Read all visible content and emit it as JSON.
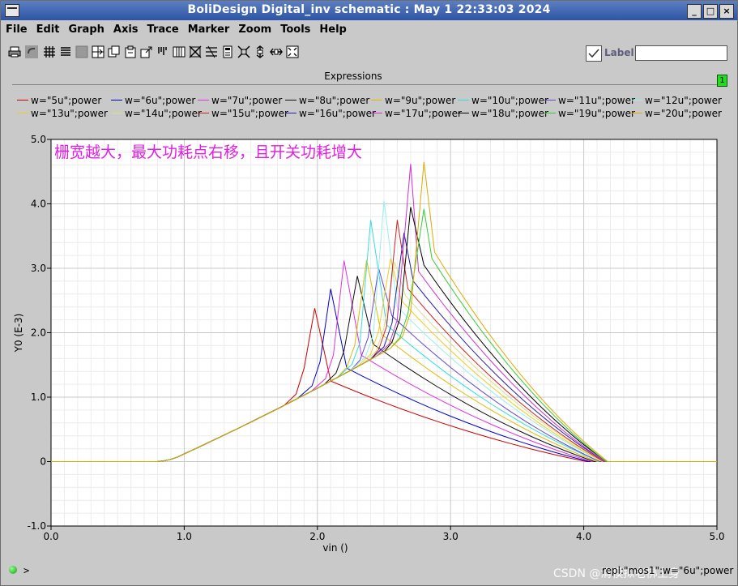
{
  "window": {
    "title": "BoliDesign Digital_inv schematic : May  1 22:33:03 2024",
    "buttons": [
      "_",
      "□",
      "×"
    ]
  },
  "menu": [
    "File",
    "Edit",
    "Graph",
    "Axis",
    "Trace",
    "Marker",
    "Zoom",
    "Tools",
    "Help"
  ],
  "toolbar": {
    "icons": [
      "print-icon",
      "undo-icon",
      "grid-icon",
      "list-icon",
      "blank-icon",
      "split-icon",
      "copy-icon",
      "paste-icon",
      "export-icon",
      "bars-icon",
      "table-icon",
      "strip-icon",
      "strip2-icon",
      "calculator-icon",
      "zoom-fit-icon",
      "zoom-x-icon",
      "zoom-y-icon",
      "zoom-in-icon"
    ],
    "label_checkbox": "Label",
    "label_value": ""
  },
  "expressions": {
    "title": "Expressions",
    "badge": "1"
  },
  "status": {
    "prompt": ">",
    "right_text": "repl:\"mos1\":w=\"6u\";power",
    "watermark": "CSDN @清模拟老梆上身"
  },
  "chart_data": {
    "type": "line",
    "annotation": "栅宽越大，最大功耗点右移，且开关功耗增大",
    "xlabel": "vin ()",
    "ylabel": "Y0 (E-3)",
    "xlim": [
      0.0,
      5.0
    ],
    "ylim": [
      -1.0,
      5.0
    ],
    "xticks": [
      "0.0",
      "1.0",
      "2.0",
      "3.0",
      "4.0",
      "5.0"
    ],
    "yticks": [
      "-1.0",
      "0",
      "1.0",
      "2.0",
      "3.0",
      "4.0",
      "5.0"
    ],
    "grid": true,
    "legend_position": "top",
    "series": [
      {
        "name": "w=\"5u\";power",
        "color": "#cc0000",
        "peak_x": 1.98,
        "peak_y": 2.38,
        "pre_x": 1.9,
        "pre_y": 1.45,
        "post_x": 2.1,
        "post_y": 1.25,
        "end_x": 4.02
      },
      {
        "name": "w=\"6u\";power",
        "color": "#0000cc",
        "peak_x": 2.1,
        "peak_y": 2.68,
        "pre_x": 2.02,
        "pre_y": 1.55,
        "post_x": 2.22,
        "post_y": 1.45,
        "end_x": 4.04
      },
      {
        "name": "w=\"7u\";power",
        "color": "#dd33dd",
        "peak_x": 2.2,
        "peak_y": 3.12,
        "pre_x": 2.12,
        "pre_y": 1.65,
        "post_x": 2.33,
        "post_y": 1.65,
        "end_x": 4.06
      },
      {
        "name": "w=\"8u\";power",
        "color": "#111111",
        "peak_x": 2.3,
        "peak_y": 2.88,
        "pre_x": 2.2,
        "pre_y": 1.72,
        "post_x": 2.42,
        "post_y": 1.82,
        "end_x": 4.08
      },
      {
        "name": "w=\"9u\";power",
        "color": "#ddbb00",
        "peak_x": 2.37,
        "peak_y": 3.13,
        "pre_x": 2.28,
        "pre_y": 1.8,
        "post_x": 2.48,
        "post_y": 1.98,
        "end_x": 4.1
      },
      {
        "name": "w=\"10u\";power",
        "color": "#33dddd",
        "peak_x": 2.4,
        "peak_y": 3.75,
        "pre_x": 2.32,
        "pre_y": 1.85,
        "post_x": 2.52,
        "post_y": 2.12,
        "end_x": 4.12
      },
      {
        "name": "w=\"11u\";power",
        "color": "#6644cc",
        "peak_x": 2.46,
        "peak_y": 3.0,
        "pre_x": 2.38,
        "pre_y": 1.92,
        "post_x": 2.56,
        "post_y": 2.26,
        "end_x": 4.12
      },
      {
        "name": "w=\"12u\";power",
        "color": "#99eeee",
        "peak_x": 2.5,
        "peak_y": 4.05,
        "pre_x": 2.42,
        "pre_y": 1.97,
        "post_x": 2.6,
        "post_y": 2.4,
        "end_x": 4.14
      },
      {
        "name": "w=\"13u\";power",
        "color": "#eecc22",
        "peak_x": 2.55,
        "peak_y": 3.15,
        "pre_x": 2.46,
        "pre_y": 2.03,
        "post_x": 2.63,
        "post_y": 2.5,
        "end_x": 4.14
      },
      {
        "name": "w=\"14u\";power",
        "color": "#dddd88",
        "peak_x": 2.58,
        "peak_y": 3.1,
        "pre_x": 2.5,
        "pre_y": 2.07,
        "post_x": 2.66,
        "post_y": 2.58,
        "end_x": 4.15
      },
      {
        "name": "w=\"15u\";power",
        "color": "#cc2222",
        "peak_x": 2.6,
        "peak_y": 3.75,
        "pre_x": 2.52,
        "pre_y": 2.1,
        "post_x": 2.68,
        "post_y": 2.68,
        "end_x": 4.15
      },
      {
        "name": "w=\"16u\";power",
        "color": "#2222aa",
        "peak_x": 2.65,
        "peak_y": 3.55,
        "pre_x": 2.56,
        "pre_y": 2.15,
        "post_x": 2.72,
        "post_y": 2.8,
        "end_x": 4.16
      },
      {
        "name": "w=\"17u\";power",
        "color": "#cc33cc",
        "peak_x": 2.7,
        "peak_y": 4.62,
        "pre_x": 2.6,
        "pre_y": 2.2,
        "post_x": 2.76,
        "post_y": 2.95,
        "end_x": 4.16
      },
      {
        "name": "w=\"18u\";power",
        "color": "#000000",
        "peak_x": 2.7,
        "peak_y": 3.95,
        "pre_x": 2.62,
        "pre_y": 2.22,
        "post_x": 2.8,
        "post_y": 3.05,
        "end_x": 4.17
      },
      {
        "name": "w=\"19u\";power",
        "color": "#33cc33",
        "peak_x": 2.8,
        "peak_y": 3.92,
        "pre_x": 2.68,
        "pre_y": 2.3,
        "post_x": 2.86,
        "post_y": 3.15,
        "end_x": 4.17
      },
      {
        "name": "w=\"20u\";power",
        "color": "#ddaa00",
        "peak_x": 2.8,
        "peak_y": 4.65,
        "pre_x": 2.7,
        "pre_y": 2.32,
        "post_x": 2.88,
        "post_y": 3.25,
        "end_x": 4.18
      }
    ]
  }
}
